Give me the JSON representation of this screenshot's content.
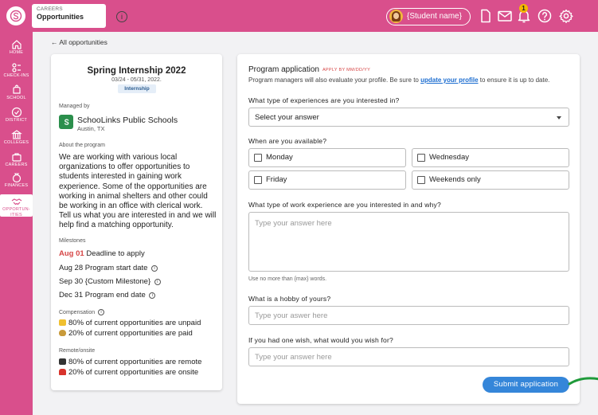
{
  "header": {
    "section_small": "CAREERS",
    "section_main": "Opportunities",
    "info_icon": "info-icon",
    "student_name": "{Student name}",
    "notification_count": "1",
    "icons": [
      "file-icon",
      "mail-icon",
      "bell-icon",
      "help-icon",
      "gear-icon"
    ],
    "brand_color": "#d94f8c"
  },
  "sidebar": {
    "items": [
      {
        "label": "HOME",
        "icon": "home-icon"
      },
      {
        "label": "CHECK-INS",
        "icon": "check-ins-icon"
      },
      {
        "label": "SCHOOL",
        "icon": "school-icon"
      },
      {
        "label": "DISTRICT",
        "icon": "district-icon"
      },
      {
        "label": "COLLEGES",
        "icon": "colleges-icon"
      },
      {
        "label": "CAREERS",
        "icon": "careers-icon"
      },
      {
        "label": "FINANCES",
        "icon": "finances-icon"
      },
      {
        "label": "OPPORTUN-",
        "label2": "ITIES",
        "icon": "handshake-icon",
        "active": true
      }
    ]
  },
  "back_link": "← All opportunities",
  "program": {
    "title": "Spring Internship 2022",
    "dates": "03/24 - 05/31, 2022.",
    "tag": "Internship",
    "managed_by_label": "Managed by",
    "school_name": "SchooLinks Public Schools",
    "school_location": "Austin, TX",
    "about_label": "About the program",
    "about_text": "We are working with various local organizations to offer opportunities to students interested in gaining work experience. Some of the opportunities are working in animal shelters and other could be working in an office with clerical work. Tell us what you are interested in and we will help find a matching opportunity.",
    "milestones_label": "Milestones",
    "milestones": [
      {
        "date": "Aug 01",
        "text": "Deadline to apply",
        "highlight": true,
        "info": false
      },
      {
        "date": "Aug 28",
        "text": "Program start date",
        "highlight": false,
        "info": true
      },
      {
        "date": "Sep 30",
        "text": "{Custom Milestone}",
        "highlight": false,
        "info": true
      },
      {
        "date": "Dec 31",
        "text": "Program end date",
        "highlight": false,
        "info": true
      }
    ],
    "compensation_label": "Compensation",
    "compensation": [
      {
        "icon": "handshake-emoji",
        "text": "80% of current opportunities are unpaid"
      },
      {
        "icon": "money-bag-emoji",
        "text": "20% of current opportunities are paid"
      }
    ],
    "remote_label": "Remote/onsite",
    "remote": [
      {
        "icon": "computer-emoji",
        "text": "80% of current opportunities are remote"
      },
      {
        "icon": "car-emoji",
        "text": "20% of current opportunities are onsite"
      }
    ]
  },
  "application": {
    "title": "Program application",
    "deadline": "APPLY BY MM/DD/YY",
    "subtitle_pre": "Program managers will also evaluate your profile. Be sure to ",
    "subtitle_link": "update your profile",
    "subtitle_post": " to ensure it is up to date.",
    "q1": "What type of experiences are you interested in?",
    "q1_value": "Select your answer",
    "q2": "When are you available?",
    "availability": [
      "Monday",
      "Wednesday",
      "Friday",
      "Weekends only"
    ],
    "q3": "What type of work experience are you interested in and why?",
    "q3_placeholder": "Type your answer here",
    "q3_helper": "Use no more than {max} words.",
    "q4": "What is a hobby of yours?",
    "q4_placeholder": "Type your aswer here",
    "q5": "If you had one wish, what would you wish for?",
    "q5_placeholder": "Type your answer here",
    "submit_label": "Submit application",
    "accent": "#3586d9"
  }
}
